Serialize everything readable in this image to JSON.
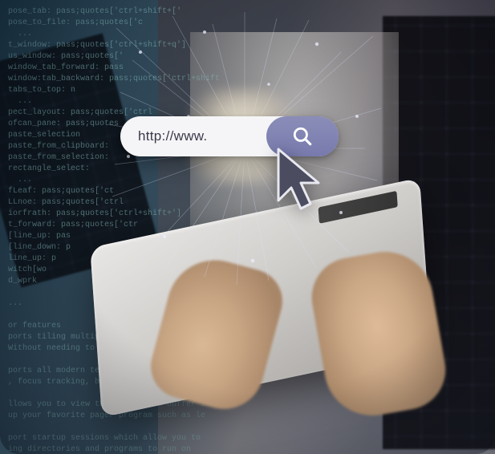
{
  "search": {
    "url_text": "http://www.",
    "button_icon": "magnifier-icon"
  },
  "cursor": {
    "icon": "pointer-arrow-icon"
  },
  "colors": {
    "search_button_bg": "#8789b5",
    "search_bar_bg": "#f5f5f7",
    "cursor_fill": "#4a4a5e"
  }
}
